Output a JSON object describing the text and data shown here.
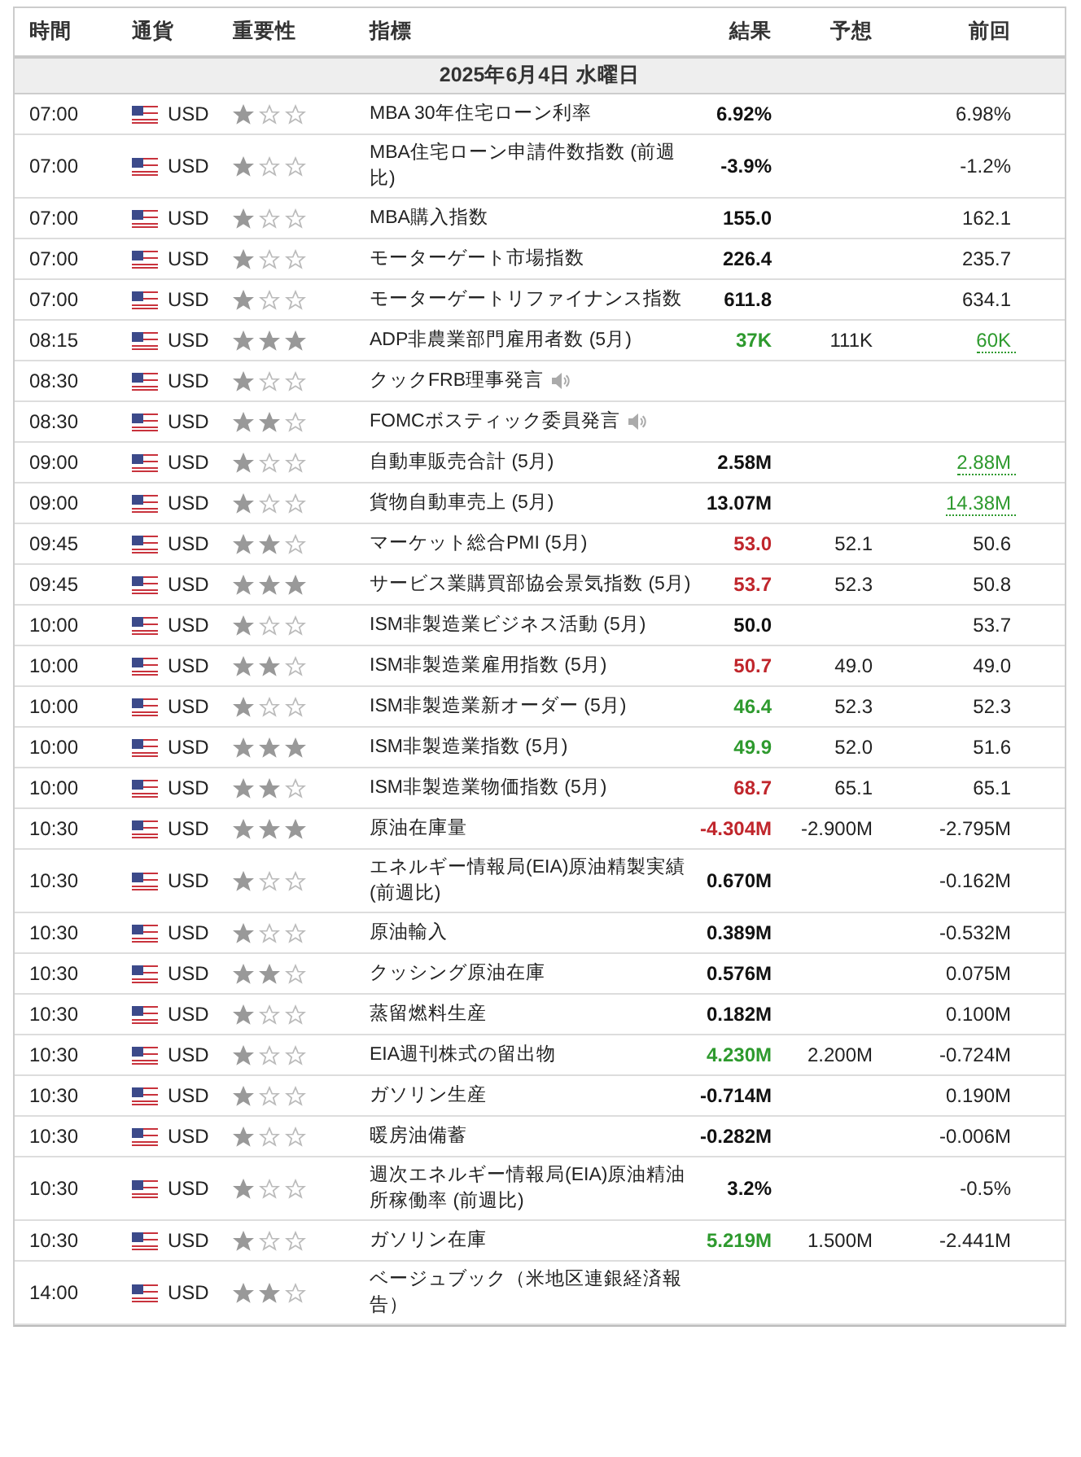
{
  "columns": [
    "時間",
    "通貨",
    "重要性",
    "指標",
    "結果",
    "予想",
    "前回"
  ],
  "date": "2025年6月4日 水曜日",
  "rows": [
    {
      "time": "07:00",
      "currency": "USD",
      "stars": 1,
      "event": "MBA 30年住宅ローン利率",
      "actual": "6.92%",
      "previous": "6.98%"
    },
    {
      "time": "07:00",
      "currency": "USD",
      "stars": 1,
      "event": "MBA住宅ローン申請件数指数 (前週比)",
      "actual": "-3.9%",
      "previous": "-1.2%"
    },
    {
      "time": "07:00",
      "currency": "USD",
      "stars": 1,
      "event": "MBA購入指数",
      "actual": "155.0",
      "previous": "162.1"
    },
    {
      "time": "07:00",
      "currency": "USD",
      "stars": 1,
      "event": "モーターゲート市場指数",
      "actual": "226.4",
      "previous": "235.7"
    },
    {
      "time": "07:00",
      "currency": "USD",
      "stars": 1,
      "event": "モーターゲートリファイナンス指数",
      "actual": "611.8",
      "previous": "634.1"
    },
    {
      "time": "08:15",
      "currency": "USD",
      "stars": 3,
      "event": "ADP非農業部門雇用者数 (5月)",
      "actual": "37K",
      "color": "#2e9a2e",
      "forecast": "111K",
      "previous": "60K",
      "previous_revised": true
    },
    {
      "time": "08:30",
      "currency": "USD",
      "stars": 1,
      "event": "クックFRB理事発言",
      "audio": true
    },
    {
      "time": "08:30",
      "currency": "USD",
      "stars": 2,
      "event": "FOMCボスティック委員発言",
      "audio": true
    },
    {
      "time": "09:00",
      "currency": "USD",
      "stars": 1,
      "event": "自動車販売合計 (5月)",
      "actual": "2.58M",
      "previous": "2.88M",
      "previous_revised": true
    },
    {
      "time": "09:00",
      "currency": "USD",
      "stars": 1,
      "event": "貨物自動車売上 (5月)",
      "actual": "13.07M",
      "previous": "14.38M",
      "previous_revised": true
    },
    {
      "time": "09:45",
      "currency": "USD",
      "stars": 2,
      "event": "マーケット総合PMI (5月)",
      "actual": "53.0",
      "color": "#c0262c",
      "forecast": "52.1",
      "previous": "50.6"
    },
    {
      "time": "09:45",
      "currency": "USD",
      "stars": 3,
      "event": "サービス業購買部協会景気指数 (5月)",
      "actual": "53.7",
      "color": "#c0262c",
      "forecast": "52.3",
      "previous": "50.8"
    },
    {
      "time": "10:00",
      "currency": "USD",
      "stars": 1,
      "event": "ISM非製造業ビジネス活動 (5月)",
      "actual": "50.0",
      "previous": "53.7"
    },
    {
      "time": "10:00",
      "currency": "USD",
      "stars": 2,
      "event": "ISM非製造業雇用指数 (5月)",
      "actual": "50.7",
      "color": "#c0262c",
      "forecast": "49.0",
      "previous": "49.0"
    },
    {
      "time": "10:00",
      "currency": "USD",
      "stars": 1,
      "event": "ISM非製造業新オーダー (5月)",
      "actual": "46.4",
      "color": "#2e9a2e",
      "forecast": "52.3",
      "previous": "52.3"
    },
    {
      "time": "10:00",
      "currency": "USD",
      "stars": 3,
      "event": "ISM非製造業指数 (5月)",
      "actual": "49.9",
      "color": "#2e9a2e",
      "forecast": "52.0",
      "previous": "51.6"
    },
    {
      "time": "10:00",
      "currency": "USD",
      "stars": 2,
      "event": "ISM非製造業物価指数 (5月)",
      "actual": "68.7",
      "color": "#c0262c",
      "forecast": "65.1",
      "previous": "65.1"
    },
    {
      "time": "10:30",
      "currency": "USD",
      "stars": 3,
      "event": "原油在庫量",
      "actual": "-4.304M",
      "color": "#c0262c",
      "forecast": "-2.900M",
      "previous": "-2.795M"
    },
    {
      "time": "10:30",
      "currency": "USD",
      "stars": 1,
      "event": "エネルギー情報局(EIA)原油精製実績 (前週比)",
      "actual": "0.670M",
      "previous": "-0.162M"
    },
    {
      "time": "10:30",
      "currency": "USD",
      "stars": 1,
      "event": "原油輸入",
      "actual": "0.389M",
      "previous": "-0.532M"
    },
    {
      "time": "10:30",
      "currency": "USD",
      "stars": 2,
      "event": "クッシング原油在庫",
      "actual": "0.576M",
      "previous": "0.075M"
    },
    {
      "time": "10:30",
      "currency": "USD",
      "stars": 1,
      "event": "蒸留燃料生産",
      "actual": "0.182M",
      "previous": "0.100M"
    },
    {
      "time": "10:30",
      "currency": "USD",
      "stars": 1,
      "event": "EIA週刊株式の留出物",
      "actual": "4.230M",
      "color": "#2e9a2e",
      "forecast": "2.200M",
      "previous": "-0.724M"
    },
    {
      "time": "10:30",
      "currency": "USD",
      "stars": 1,
      "event": "ガソリン生産",
      "actual": "-0.714M",
      "previous": "0.190M"
    },
    {
      "time": "10:30",
      "currency": "USD",
      "stars": 1,
      "event": "暖房油備蓄",
      "actual": "-0.282M",
      "previous": "-0.006M"
    },
    {
      "time": "10:30",
      "currency": "USD",
      "stars": 1,
      "event": "週次エネルギー情報局(EIA)原油精油所稼働率 (前週比)",
      "actual": "3.2%",
      "previous": "-0.5%"
    },
    {
      "time": "10:30",
      "currency": "USD",
      "stars": 1,
      "event": "ガソリン在庫",
      "actual": "5.219M",
      "color": "#2e9a2e",
      "forecast": "1.500M",
      "previous": "-2.441M"
    },
    {
      "time": "14:00",
      "currency": "USD",
      "stars": 2,
      "event": "ベージュブック（米地区連銀経済報告）"
    }
  ]
}
